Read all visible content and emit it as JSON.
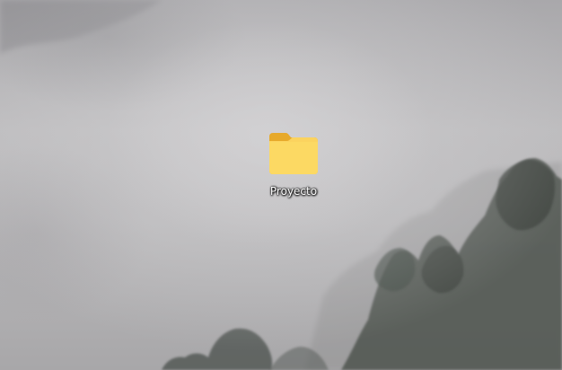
{
  "desktop": {
    "wallpaper": "foggy-forest-wallpaper",
    "icons": [
      {
        "label": "Proyecto",
        "icon": "folder-icon",
        "color": "#f8cf4f"
      }
    ]
  }
}
